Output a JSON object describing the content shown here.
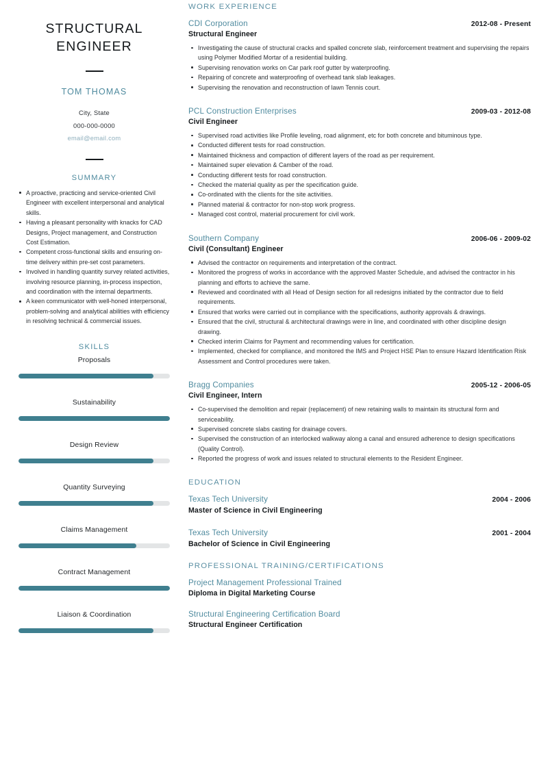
{
  "sidebar": {
    "headline": "Structural Engineer",
    "name": "Tom Thomas",
    "location": "City, State",
    "phone": "000-000-0000",
    "email": "email@email.com",
    "summary_heading": "Summary",
    "summary_items": [
      "A proactive, practicing and service-oriented Civil Engineer with excellent interpersonal and analytical skills.",
      "Having a pleasant personality with knacks for CAD Designs, Project management, and Construction Cost Estimation.",
      "Competent cross-functional skills and ensuring on-time delivery within pre-set cost parameters.",
      "Involved in handling quantity survey related activities, involving resource planning, in-process inspection, and coordination with the internal departments.",
      "A keen communicator with well-honed interpersonal, problem-solving and analytical abilities with efficiency in resolving technical & commercial issues."
    ],
    "skills_heading": "Skills",
    "skills": [
      {
        "label": "Proposals",
        "level": 89
      },
      {
        "label": "Sustainability",
        "level": 100
      },
      {
        "label": "Design Review",
        "level": 89
      },
      {
        "label": "Quantity Surveying",
        "level": 89
      },
      {
        "label": "Claims Management",
        "level": 78
      },
      {
        "label": "Contract Management",
        "level": 100
      },
      {
        "label": "Liaison & Coordination",
        "level": 89
      }
    ]
  },
  "main": {
    "work_heading": "Work Experience",
    "work_entries": [
      {
        "org": "CDI Corporation",
        "date": "2012-08 - Present",
        "role": "Structural Engineer",
        "bullets": [
          "Investigating the cause of structural cracks and spalled concrete slab, reinforcement treatment and supervising the repairs using Polymer Modified Mortar of a residential building.",
          "Supervising renovation works on Car park roof gutter by waterproofing.",
          "Repairing of concrete and waterproofing of overhead tank slab leakages.",
          "Supervising the renovation and reconstruction of lawn Tennis court."
        ]
      },
      {
        "org": "PCL Construction Enterprises",
        "date": "2009-03 - 2012-08",
        "role": "Civil Engineer",
        "bullets": [
          "Supervised road activities like Profile leveling, road alignment, etc for both concrete and bituminous type.",
          "Conducted different tests for road construction.",
          "Maintained thickness and compaction of different layers of the road as per requirement.",
          "Maintained super elevation & Camber of the road.",
          "Conducting different tests for road construction.",
          "Checked the material quality as per the specification guide.",
          "Co-ordinated with the clients for the site activities.",
          "Planned material & contractor for non-stop work progress.",
          "Managed cost control, material procurement for civil work."
        ]
      },
      {
        "org": "Southern Company",
        "date": "2006-06 - 2009-02",
        "role": "Civil (Consultant) Engineer",
        "bullets": [
          "Advised the contractor on requirements and interpretation of the contract.",
          "Monitored the progress of works in accordance with the approved Master Schedule, and advised the contractor in his planning and efforts to achieve the same.",
          "Reviewed and coordinated with all Head of Design section for all redesigns initiated by the contractor due to field requirements.",
          "Ensured that works were carried out in compliance with the specifications, authority approvals & drawings.",
          "Ensured that the civil, structural & architectural drawings were in line, and coordinated with other discipline design drawing.",
          "Checked interim Claims for Payment and recommending values for certification.",
          "Implemented, checked for compliance, and monitored the IMS and Project HSE Plan to ensure Hazard Identification Risk Assessment and Control procedures were taken."
        ]
      },
      {
        "org": "Bragg Companies",
        "date": "2005-12 - 2006-05",
        "role": "Civil Engineer, Intern",
        "bullets": [
          "Co-supervised the demolition and repair (replacement) of new retaining walls to maintain its structural form and serviceability.",
          "Supervised concrete slabs casting for drainage covers.",
          "Supervised the construction of an interlocked walkway along a canal and ensured adherence to design specifications (Quality Control).",
          "Reported the progress of work and issues related to structural elements to the Resident Engineer."
        ]
      }
    ],
    "education_heading": "Education",
    "education_entries": [
      {
        "org": "Texas Tech University",
        "date": "2004 - 2006",
        "role": "Master of Science in Civil Engineering"
      },
      {
        "org": "Texas Tech University",
        "date": "2001 - 2004",
        "role": "Bachelor of Science in Civil Engineering"
      }
    ],
    "certifications_heading": "Professional Training/Certifications",
    "certification_entries": [
      {
        "org": "Project Management Professional Trained",
        "date": "",
        "role": "Diploma in Digital Marketing Course"
      },
      {
        "org": "Structural Engineering Certification Board",
        "date": "",
        "role": "Structural Engineer Certification"
      }
    ]
  },
  "theme": {
    "accent_teal": "#3f7f8f",
    "accent_steel": "#5b8fa3",
    "text_dark": "#15191c",
    "track_grey": "#e3e5e6"
  }
}
